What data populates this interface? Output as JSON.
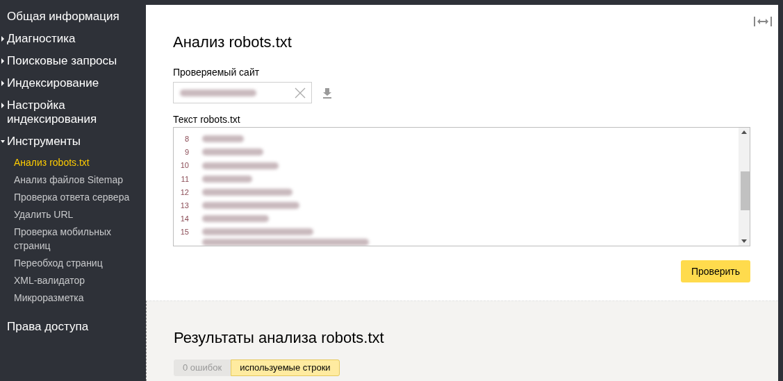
{
  "sidebar": {
    "sections": [
      {
        "label": "Общая информация",
        "kind": "link"
      },
      {
        "label": "Диагностика",
        "kind": "group",
        "expanded": false
      },
      {
        "label": "Поисковые запросы",
        "kind": "group",
        "expanded": false
      },
      {
        "label": "Индексирование",
        "kind": "group",
        "expanded": false
      },
      {
        "label": "Настройка индексирования",
        "kind": "group",
        "expanded": false
      },
      {
        "label": "Инструменты",
        "kind": "group",
        "expanded": true,
        "children": [
          {
            "label": "Анализ robots.txt",
            "selected": true
          },
          {
            "label": "Анализ файлов Sitemap",
            "selected": false
          },
          {
            "label": "Проверка ответа сервера",
            "selected": false
          },
          {
            "label": "Удалить URL",
            "selected": false
          },
          {
            "label": "Проверка мобильных страниц",
            "selected": false
          },
          {
            "label": "Переобход страниц",
            "selected": false
          },
          {
            "label": "XML-валидатор",
            "selected": false
          },
          {
            "label": "Микроразметка",
            "selected": false
          }
        ]
      },
      {
        "label": "Права доступа",
        "kind": "link"
      }
    ]
  },
  "main": {
    "title": "Анализ robots.txt",
    "site_label": "Проверяемый сайт",
    "robots_label": "Текст robots.txt",
    "line_numbers": [
      "8",
      "9",
      "10",
      "11",
      "12",
      "13",
      "14",
      "15"
    ],
    "check_button": "Проверить"
  },
  "results": {
    "title": "Результаты анализа robots.txt",
    "tabs": [
      {
        "label": "0 ошибок",
        "selected": false
      },
      {
        "label": "используемые строки",
        "selected": true
      }
    ]
  }
}
